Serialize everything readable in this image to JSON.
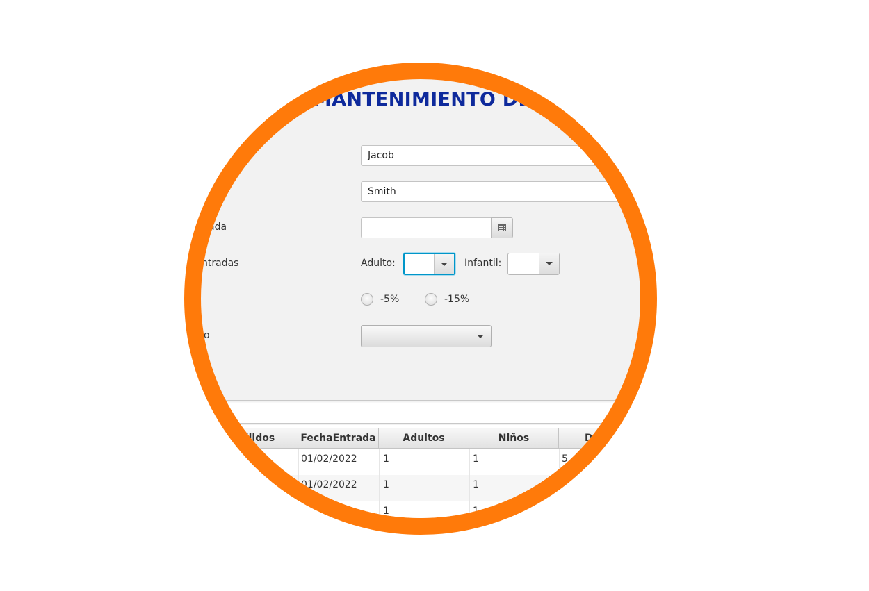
{
  "header": {
    "title": "MANTENIMIENTO DE"
  },
  "form": {
    "nombre_value": "Jacob",
    "apellidos_value": "Smith",
    "fecha_label": "ada",
    "fecha_value": "",
    "entradas_label": "ntradas",
    "adulto_label": "Adulto:",
    "adulto_value": "",
    "infantil_label": "Infantil:",
    "infantil_value": "",
    "descuento_options": [
      "-5%",
      "-15%"
    ],
    "tipo_label": "o",
    "tipo_value": ""
  },
  "table": {
    "columns": [
      "llidos",
      "FechaEntrada",
      "Adultos",
      "Niños",
      "De"
    ],
    "rows": [
      [
        "",
        "01/02/2022",
        "1",
        "1",
        "5"
      ],
      [
        "",
        "01/02/2022",
        "1",
        "1",
        ""
      ],
      [
        "",
        "",
        "1",
        "1",
        ""
      ]
    ]
  },
  "colors": {
    "accent_ring": "#ff7a0a",
    "title": "#0e2a9c",
    "focus": "#0096c9"
  },
  "icons": [
    "calendar-icon",
    "chevron-down-icon"
  ]
}
